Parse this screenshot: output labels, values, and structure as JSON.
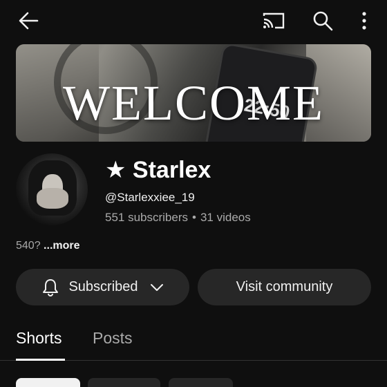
{
  "topbar": {
    "back_icon": "arrow-left-icon",
    "cast_icon": "cast-icon",
    "search_icon": "search-icon",
    "more_icon": "more-vertical-icon"
  },
  "banner": {
    "headline": "WELCOME",
    "phone_time": "22:50"
  },
  "channel": {
    "name": "★ Starlex",
    "handle": "@Starlexxiee_19",
    "subscribers": "551 subscribers",
    "separator": "•",
    "videos": "31 videos",
    "description": "540?",
    "more_label": "...more"
  },
  "actions": {
    "subscribed_label": "Subscribed",
    "community_label": "Visit community"
  },
  "tabs": [
    {
      "label": "Shorts",
      "selected": true
    },
    {
      "label": "Posts",
      "selected": false
    }
  ],
  "colors": {
    "background": "#0f0f0f",
    "pill": "#272727",
    "secondary_text": "#aaaaaa"
  }
}
